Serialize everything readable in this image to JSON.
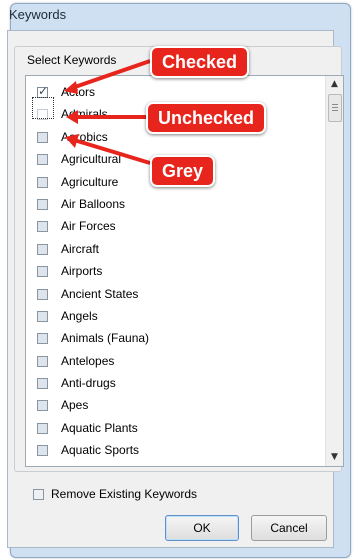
{
  "dialog": {
    "title": "Keywords",
    "group_label": "Select Keywords",
    "items": [
      {
        "label": "Actors",
        "state": "checked"
      },
      {
        "label": "Admirals",
        "state": "unchecked"
      },
      {
        "label": "Aerobics",
        "state": "grey"
      },
      {
        "label": "Agricultural",
        "state": "grey"
      },
      {
        "label": "Agriculture",
        "state": "grey"
      },
      {
        "label": "Air Balloons",
        "state": "grey"
      },
      {
        "label": "Air Forces",
        "state": "grey"
      },
      {
        "label": "Aircraft",
        "state": "grey"
      },
      {
        "label": "Airports",
        "state": "grey"
      },
      {
        "label": "Ancient States",
        "state": "grey"
      },
      {
        "label": "Angels",
        "state": "grey"
      },
      {
        "label": "Animals (Fauna)",
        "state": "grey"
      },
      {
        "label": "Antelopes",
        "state": "grey"
      },
      {
        "label": "Anti-drugs",
        "state": "grey"
      },
      {
        "label": "Apes",
        "state": "grey"
      },
      {
        "label": "Aquatic Plants",
        "state": "grey"
      },
      {
        "label": "Aquatic Sports",
        "state": "grey"
      }
    ],
    "remove_existing_label": "Remove Existing Keywords",
    "ok_label": "OK",
    "cancel_label": "Cancel"
  },
  "annotations": {
    "checked": "Checked",
    "unchecked": "Unchecked",
    "grey": "Grey",
    "color": "#e8251c"
  }
}
